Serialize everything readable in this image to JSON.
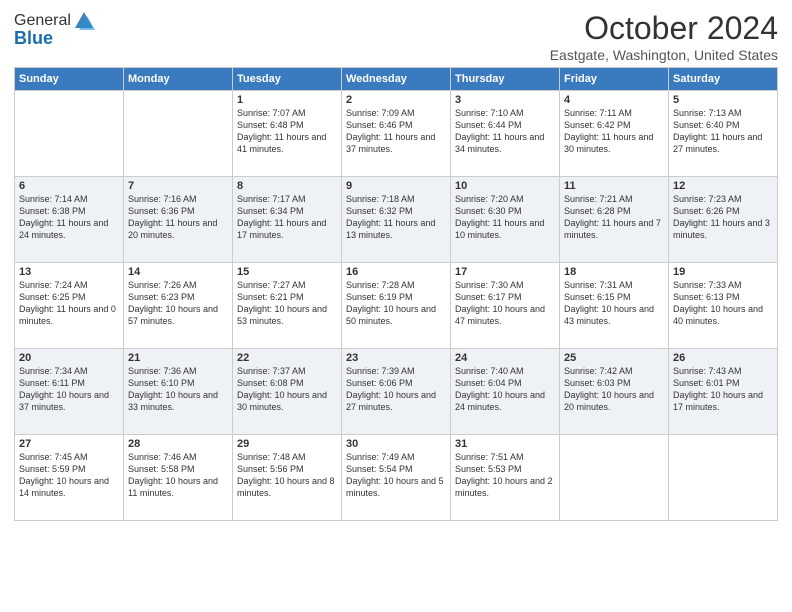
{
  "header": {
    "logo_general": "General",
    "logo_blue": "Blue",
    "month": "October 2024",
    "location": "Eastgate, Washington, United States"
  },
  "weekdays": [
    "Sunday",
    "Monday",
    "Tuesday",
    "Wednesday",
    "Thursday",
    "Friday",
    "Saturday"
  ],
  "weeks": [
    [
      {
        "day": "",
        "info": ""
      },
      {
        "day": "",
        "info": ""
      },
      {
        "day": "1",
        "info": "Sunrise: 7:07 AM\nSunset: 6:48 PM\nDaylight: 11 hours and 41 minutes."
      },
      {
        "day": "2",
        "info": "Sunrise: 7:09 AM\nSunset: 6:46 PM\nDaylight: 11 hours and 37 minutes."
      },
      {
        "day": "3",
        "info": "Sunrise: 7:10 AM\nSunset: 6:44 PM\nDaylight: 11 hours and 34 minutes."
      },
      {
        "day": "4",
        "info": "Sunrise: 7:11 AM\nSunset: 6:42 PM\nDaylight: 11 hours and 30 minutes."
      },
      {
        "day": "5",
        "info": "Sunrise: 7:13 AM\nSunset: 6:40 PM\nDaylight: 11 hours and 27 minutes."
      }
    ],
    [
      {
        "day": "6",
        "info": "Sunrise: 7:14 AM\nSunset: 6:38 PM\nDaylight: 11 hours and 24 minutes."
      },
      {
        "day": "7",
        "info": "Sunrise: 7:16 AM\nSunset: 6:36 PM\nDaylight: 11 hours and 20 minutes."
      },
      {
        "day": "8",
        "info": "Sunrise: 7:17 AM\nSunset: 6:34 PM\nDaylight: 11 hours and 17 minutes."
      },
      {
        "day": "9",
        "info": "Sunrise: 7:18 AM\nSunset: 6:32 PM\nDaylight: 11 hours and 13 minutes."
      },
      {
        "day": "10",
        "info": "Sunrise: 7:20 AM\nSunset: 6:30 PM\nDaylight: 11 hours and 10 minutes."
      },
      {
        "day": "11",
        "info": "Sunrise: 7:21 AM\nSunset: 6:28 PM\nDaylight: 11 hours and 7 minutes."
      },
      {
        "day": "12",
        "info": "Sunrise: 7:23 AM\nSunset: 6:26 PM\nDaylight: 11 hours and 3 minutes."
      }
    ],
    [
      {
        "day": "13",
        "info": "Sunrise: 7:24 AM\nSunset: 6:25 PM\nDaylight: 11 hours and 0 minutes."
      },
      {
        "day": "14",
        "info": "Sunrise: 7:26 AM\nSunset: 6:23 PM\nDaylight: 10 hours and 57 minutes."
      },
      {
        "day": "15",
        "info": "Sunrise: 7:27 AM\nSunset: 6:21 PM\nDaylight: 10 hours and 53 minutes."
      },
      {
        "day": "16",
        "info": "Sunrise: 7:28 AM\nSunset: 6:19 PM\nDaylight: 10 hours and 50 minutes."
      },
      {
        "day": "17",
        "info": "Sunrise: 7:30 AM\nSunset: 6:17 PM\nDaylight: 10 hours and 47 minutes."
      },
      {
        "day": "18",
        "info": "Sunrise: 7:31 AM\nSunset: 6:15 PM\nDaylight: 10 hours and 43 minutes."
      },
      {
        "day": "19",
        "info": "Sunrise: 7:33 AM\nSunset: 6:13 PM\nDaylight: 10 hours and 40 minutes."
      }
    ],
    [
      {
        "day": "20",
        "info": "Sunrise: 7:34 AM\nSunset: 6:11 PM\nDaylight: 10 hours and 37 minutes."
      },
      {
        "day": "21",
        "info": "Sunrise: 7:36 AM\nSunset: 6:10 PM\nDaylight: 10 hours and 33 minutes."
      },
      {
        "day": "22",
        "info": "Sunrise: 7:37 AM\nSunset: 6:08 PM\nDaylight: 10 hours and 30 minutes."
      },
      {
        "day": "23",
        "info": "Sunrise: 7:39 AM\nSunset: 6:06 PM\nDaylight: 10 hours and 27 minutes."
      },
      {
        "day": "24",
        "info": "Sunrise: 7:40 AM\nSunset: 6:04 PM\nDaylight: 10 hours and 24 minutes."
      },
      {
        "day": "25",
        "info": "Sunrise: 7:42 AM\nSunset: 6:03 PM\nDaylight: 10 hours and 20 minutes."
      },
      {
        "day": "26",
        "info": "Sunrise: 7:43 AM\nSunset: 6:01 PM\nDaylight: 10 hours and 17 minutes."
      }
    ],
    [
      {
        "day": "27",
        "info": "Sunrise: 7:45 AM\nSunset: 5:59 PM\nDaylight: 10 hours and 14 minutes."
      },
      {
        "day": "28",
        "info": "Sunrise: 7:46 AM\nSunset: 5:58 PM\nDaylight: 10 hours and 11 minutes."
      },
      {
        "day": "29",
        "info": "Sunrise: 7:48 AM\nSunset: 5:56 PM\nDaylight: 10 hours and 8 minutes."
      },
      {
        "day": "30",
        "info": "Sunrise: 7:49 AM\nSunset: 5:54 PM\nDaylight: 10 hours and 5 minutes."
      },
      {
        "day": "31",
        "info": "Sunrise: 7:51 AM\nSunset: 5:53 PM\nDaylight: 10 hours and 2 minutes."
      },
      {
        "day": "",
        "info": ""
      },
      {
        "day": "",
        "info": ""
      }
    ]
  ]
}
